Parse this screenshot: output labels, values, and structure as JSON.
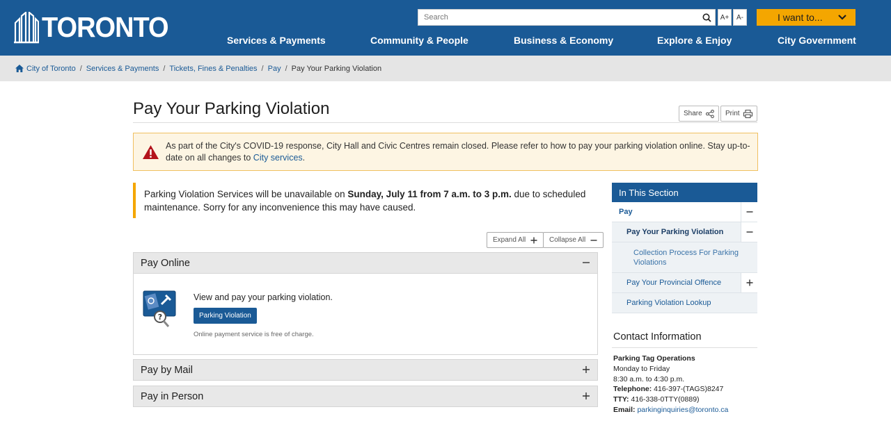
{
  "header": {
    "logo_text": "TORONTO",
    "search_placeholder": "Search",
    "font_increase": "A+",
    "font_decrease": "A-",
    "i_want_to": "I want to...",
    "nav": [
      "Services & Payments",
      "Community & People",
      "Business & Economy",
      "Explore & Enjoy",
      "City Government"
    ],
    "brand_color": "#1a5a96",
    "accent_color": "#f4a600"
  },
  "breadcrumb": {
    "items": [
      "City of Toronto",
      "Services & Payments",
      "Tickets, Fines & Penalties",
      "Pay"
    ],
    "current": "Pay Your Parking Violation",
    "separator": "/"
  },
  "page": {
    "title": "Pay Your Parking Violation",
    "share_label": "Share",
    "print_label": "Print"
  },
  "covid_alert": {
    "text": "As part of the City's COVID-19 response, City Hall and Civic Centres remain closed. Please refer to how to pay your parking violation online. Stay up-to-date on all changes to ",
    "link": "City services",
    "trailing": "."
  },
  "notice": {
    "before": "Parking Violation Services will be unavailable on ",
    "bold": "Sunday, July 11 from 7 a.m. to 3 p.m.",
    "after": " due to scheduled maintenance. Sorry for any inconvenience this may have caused."
  },
  "accordion": {
    "expand_all": "Expand All",
    "collapse_all": "Collapse All",
    "sections": [
      {
        "title": "Pay Online",
        "expanded": true
      },
      {
        "title": "Pay by Mail",
        "expanded": false
      },
      {
        "title": "Pay in Person",
        "expanded": false
      }
    ],
    "online": {
      "intro": "View and pay your parking violation.",
      "button": "Parking Violation",
      "note": "Online payment service is free of charge."
    }
  },
  "sidebar": {
    "heading": "In This Section",
    "items": [
      {
        "label": "Pay",
        "toggle": "−"
      },
      {
        "label": "Pay Your Parking Violation",
        "toggle": "−"
      },
      {
        "label": "Collection Process For Parking Violations",
        "toggle": ""
      },
      {
        "label": "Pay Your Provincial Offence",
        "toggle": "+"
      },
      {
        "label": "Parking Violation Lookup",
        "toggle": ""
      }
    ]
  },
  "contact": {
    "heading": "Contact Information",
    "org": "Parking Tag Operations",
    "days": "Monday to Friday",
    "hours": "8:30 a.m. to 4:30 p.m.",
    "telephone_label": "Telephone:",
    "telephone": "416-397-(TAGS)8247",
    "tty_label": "TTY:",
    "tty": "416-338-0TTY(0889)",
    "email_label": "Email:",
    "email": "parkinginquiries@toronto.ca"
  }
}
